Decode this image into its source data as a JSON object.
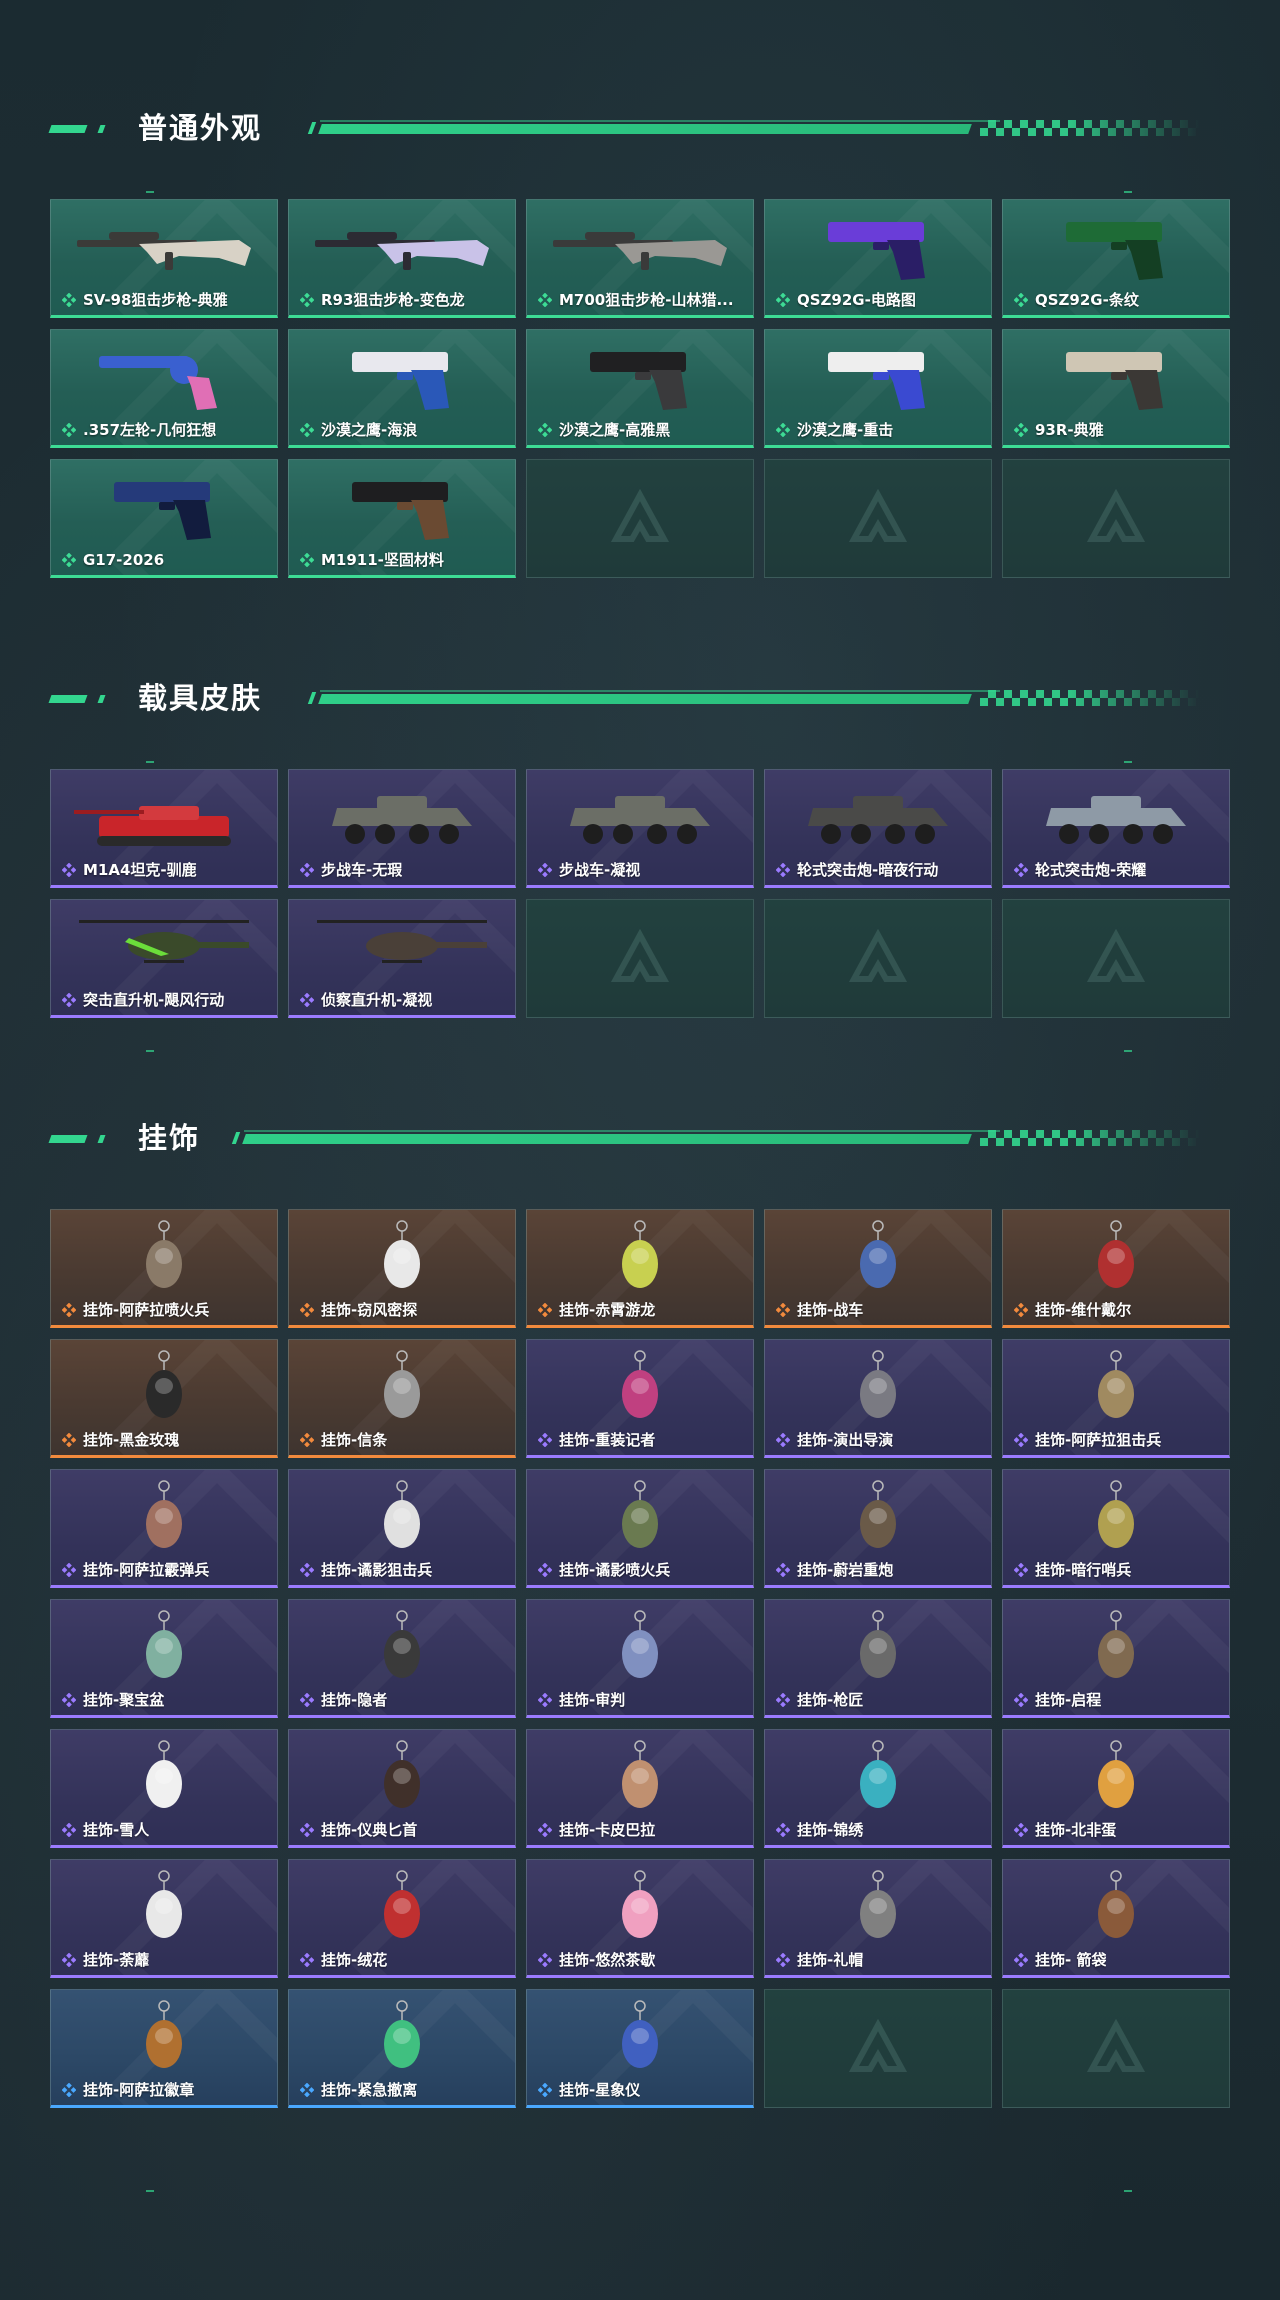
{
  "sections": {
    "weapon_skins": {
      "title": "普通外观",
      "items": [
        {
          "label": "SV-98狙击步枪-典雅",
          "icon": "sniper-rifle-icon"
        },
        {
          "label": "R93狙击步枪-变色龙",
          "icon": "sniper-rifle-icon"
        },
        {
          "label": "M700狙击步枪-山林猎...",
          "icon": "sniper-rifle-icon"
        },
        {
          "label": "QSZ92G-电路图",
          "icon": "pistol-icon"
        },
        {
          "label": "QSZ92G-条纹",
          "icon": "pistol-icon"
        },
        {
          "label": ".357左轮-几何狂想",
          "icon": "revolver-icon"
        },
        {
          "label": "沙漠之鹰-海浪",
          "icon": "pistol-icon"
        },
        {
          "label": "沙漠之鹰-高雅黑",
          "icon": "pistol-icon"
        },
        {
          "label": "沙漠之鹰-重击",
          "icon": "pistol-icon"
        },
        {
          "label": "93R-典雅",
          "icon": "pistol-icon"
        },
        {
          "label": "G17-2026",
          "icon": "pistol-icon"
        },
        {
          "label": "M1911-坚固材料",
          "icon": "pistol-icon"
        }
      ]
    },
    "vehicle_skins": {
      "title": "载具皮肤",
      "items": [
        {
          "label": "M1A4坦克-驯鹿",
          "icon": "tank-icon"
        },
        {
          "label": "步战车-无瑕",
          "icon": "apc-icon"
        },
        {
          "label": "步战车-凝视",
          "icon": "apc-icon"
        },
        {
          "label": "轮式突击炮-暗夜行动",
          "icon": "armored-car-icon"
        },
        {
          "label": "轮式突击炮-荣耀",
          "icon": "armored-car-icon"
        },
        {
          "label": "突击直升机-飓风行动",
          "icon": "helicopter-icon"
        },
        {
          "label": "侦察直升机-凝视",
          "icon": "helicopter-icon"
        }
      ]
    },
    "charms": {
      "title": "挂饰",
      "items": [
        {
          "label": "挂饰-阿萨拉喷火兵",
          "rarity": "orange"
        },
        {
          "label": "挂饰-窃风密探",
          "rarity": "orange"
        },
        {
          "label": "挂饰-赤霄游龙",
          "rarity": "orange"
        },
        {
          "label": "挂饰-战车",
          "rarity": "orange"
        },
        {
          "label": "挂饰-维什戴尔",
          "rarity": "orange"
        },
        {
          "label": "挂饰-黑金玫瑰",
          "rarity": "orange"
        },
        {
          "label": "挂饰-信条",
          "rarity": "orange"
        },
        {
          "label": "挂饰-重装记者",
          "rarity": "purple"
        },
        {
          "label": "挂饰-演出导演",
          "rarity": "purple"
        },
        {
          "label": "挂饰-阿萨拉狙击兵",
          "rarity": "purple"
        },
        {
          "label": "挂饰-阿萨拉霰弹兵",
          "rarity": "purple"
        },
        {
          "label": "挂饰-谲影狙击兵",
          "rarity": "purple"
        },
        {
          "label": "挂饰-谲影喷火兵",
          "rarity": "purple"
        },
        {
          "label": "挂饰-蔚岩重炮",
          "rarity": "purple"
        },
        {
          "label": "挂饰-暗行哨兵",
          "rarity": "purple"
        },
        {
          "label": "挂饰-聚宝盆",
          "rarity": "purple"
        },
        {
          "label": "挂饰-隐者",
          "rarity": "purple"
        },
        {
          "label": "挂饰-审判",
          "rarity": "purple"
        },
        {
          "label": "挂饰-枪匠",
          "rarity": "purple"
        },
        {
          "label": "挂饰-启程",
          "rarity": "purple"
        },
        {
          "label": "挂饰-雪人",
          "rarity": "purple"
        },
        {
          "label": "挂饰-仪典匕首",
          "rarity": "purple"
        },
        {
          "label": "挂饰-卡皮巴拉",
          "rarity": "purple"
        },
        {
          "label": "挂饰-锦绣",
          "rarity": "purple"
        },
        {
          "label": "挂饰-北非蛋",
          "rarity": "purple"
        },
        {
          "label": "挂饰-荼蘼",
          "rarity": "purple"
        },
        {
          "label": "挂饰-绒花",
          "rarity": "purple"
        },
        {
          "label": "挂饰-悠然茶歇",
          "rarity": "purple"
        },
        {
          "label": "挂饰-礼帽",
          "rarity": "purple"
        },
        {
          "label": "挂饰- 箭袋",
          "rarity": "purple"
        },
        {
          "label": "挂饰-阿萨拉徽章",
          "rarity": "blue"
        },
        {
          "label": "挂饰-紧急撤离",
          "rarity": "blue"
        },
        {
          "label": "挂饰-星象仪",
          "rarity": "blue"
        }
      ]
    }
  },
  "colors": {
    "accent": "#33d68f",
    "rarity_green": "#3ddc95",
    "rarity_purple": "#9b7bff",
    "rarity_orange": "#f28a3d",
    "rarity_blue": "#4aa8ff"
  }
}
